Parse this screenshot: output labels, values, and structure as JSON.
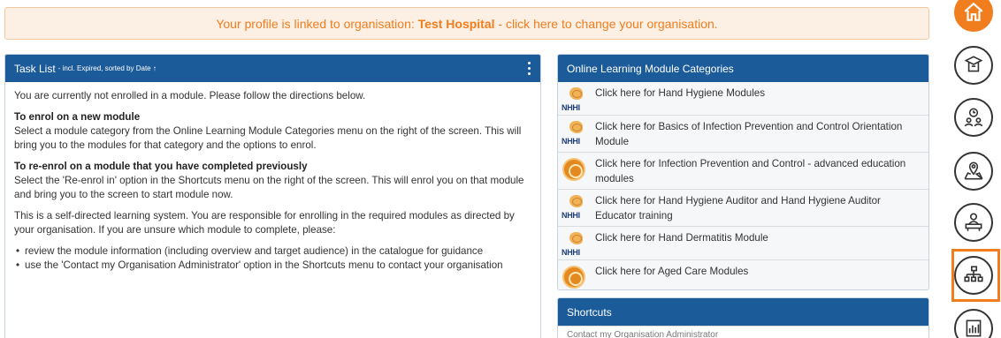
{
  "banner": {
    "text_before": "Your profile is linked to organisation: ",
    "org_name": "Test Hospital",
    "text_after": " - click here to change your organisation."
  },
  "task_list": {
    "title": "Task List",
    "subtitle": "- incl. Expired, sorted by Date ↑",
    "intro": "You are currently not enrolled in a module. Please follow the directions below.",
    "enrol_heading": "To enrol on a new module",
    "enrol_text": "Select a module category from the Online Learning Module Categories menu on the right of the screen. This will bring you to the modules for that category and the options to enrol.",
    "reenrol_heading": "To re-enrol on a module that you have completed previously",
    "reenrol_text": "Select the 'Re-enrol in' option in the Shortcuts menu on the right of the screen. This will enrol you on that module and bring you to the screen to start module now.",
    "self_directed": "This is a self-directed learning system. You are responsible for enrolling in the required modules as directed by your organisation. If you are unsure which module to complete, please:",
    "bullets": [
      "review the module information (including overview and target audience) in the catalogue for guidance",
      "use the 'Contact my Organisation Administrator' option in the Shortcuts menu to contact your organisation"
    ]
  },
  "categories": {
    "title": "Online Learning Module Categories",
    "items": [
      {
        "label": "Click here for Hand Hygiene Modules",
        "logo": "nhhi-logo",
        "logo_text": "NHHI"
      },
      {
        "label": "Click here for Basics of Infection Prevention and Control Orientation Module",
        "logo": "nhhi-logo",
        "logo_text": "NHHI"
      },
      {
        "label": "Click here for Infection Prevention and Control - advanced education modules",
        "logo": "orange-circle-logo",
        "logo_text": ""
      },
      {
        "label": "Click here for Hand Hygiene Auditor and Hand Hygiene Auditor Educator training",
        "logo": "nhhi-logo",
        "logo_text": "NHHI"
      },
      {
        "label": "Click here for Hand Dermatitis Module",
        "logo": "nhhi-logo",
        "logo_text": "NHHI"
      },
      {
        "label": "Click here for Aged Care Modules",
        "logo": "orange-circle-logo",
        "logo_text": ""
      }
    ]
  },
  "shortcuts": {
    "title": "Shortcuts",
    "first_item": "Contact my Organisation Administrator"
  },
  "side_nav": [
    {
      "icon": "home-icon"
    },
    {
      "icon": "graduation-book-icon"
    },
    {
      "icon": "clock-people-icon"
    },
    {
      "icon": "map-pin-icon"
    },
    {
      "icon": "desk-person-icon"
    },
    {
      "icon": "org-chart-icon"
    },
    {
      "icon": "report-chart-icon"
    }
  ],
  "colors": {
    "accent": "#f07d1e",
    "header_blue": "#1c5b9a"
  }
}
